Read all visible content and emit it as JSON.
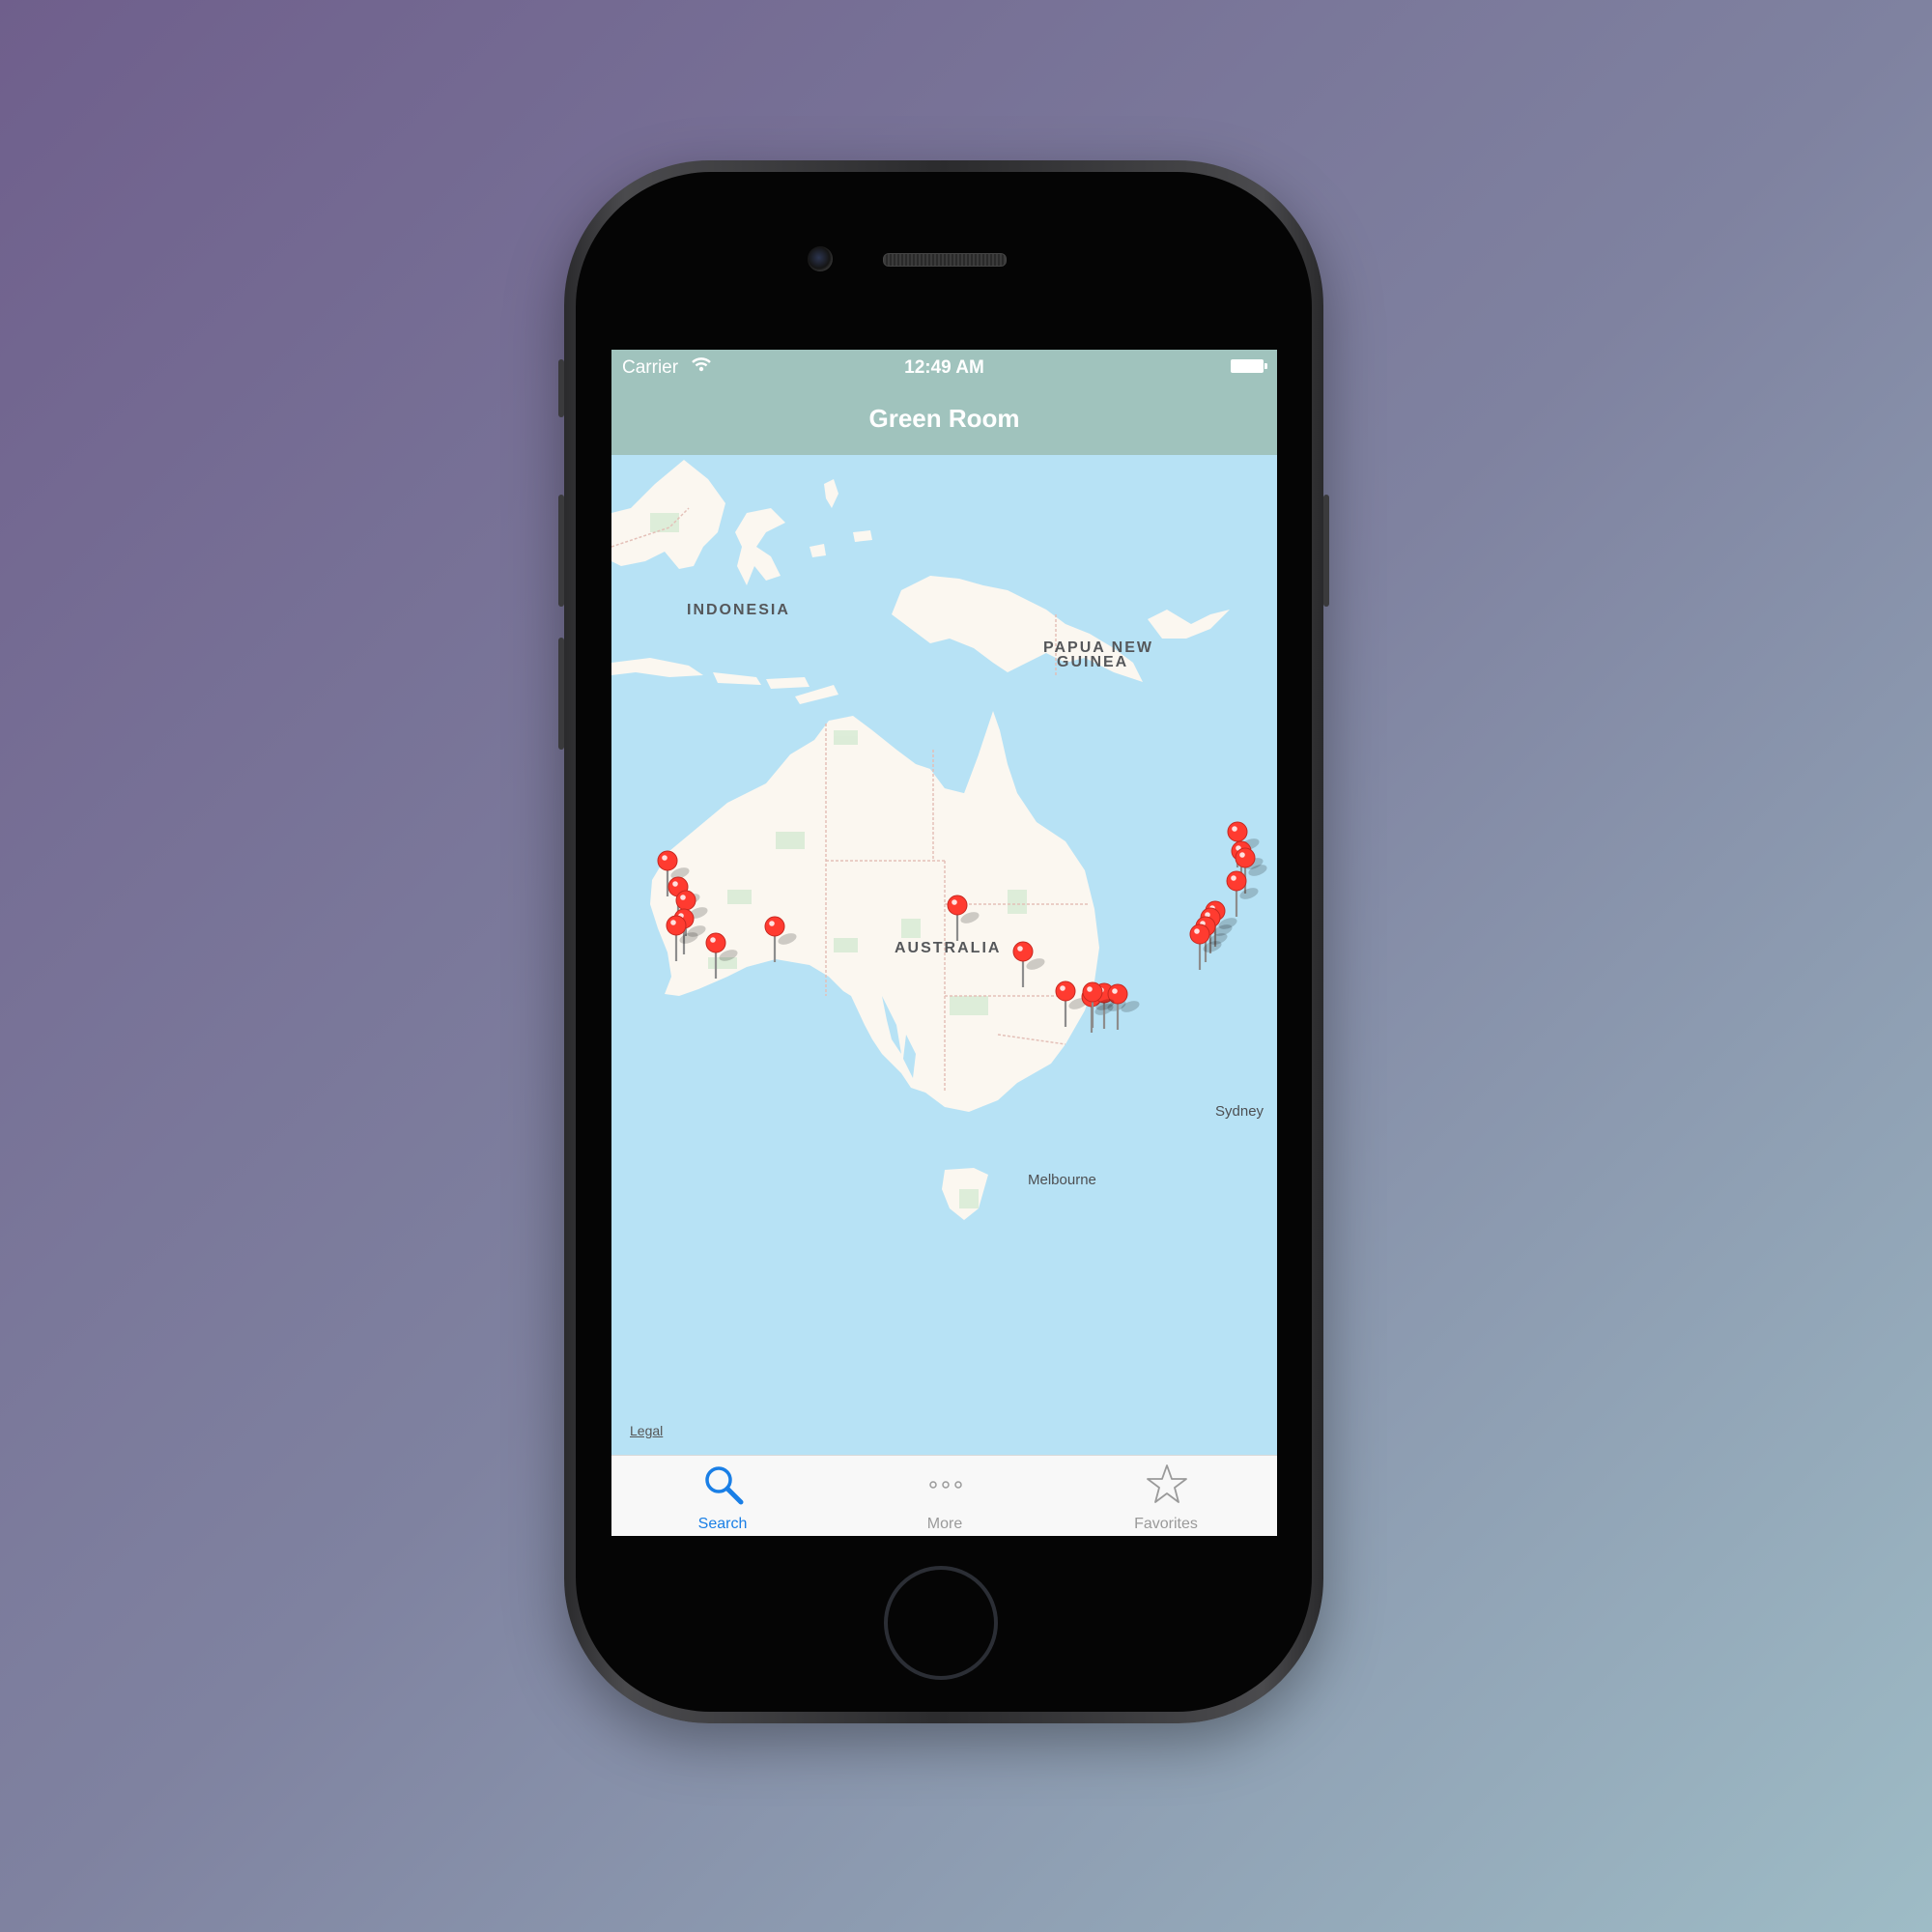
{
  "status_bar": {
    "carrier": "Carrier",
    "time": "12:49 AM"
  },
  "nav_bar": {
    "title": "Green Room"
  },
  "map": {
    "labels": {
      "indonesia": "INDONESIA",
      "png_line1": "PAPUA NEW",
      "png_line2": "GUINEA",
      "australia": "AUSTRALIA"
    },
    "cities": {
      "sydney": "Sydney",
      "melbourne": "Melbourne"
    },
    "legal": "Legal",
    "pin_color": "#ff3b30"
  },
  "tab_bar": {
    "tabs": [
      {
        "label": "Search",
        "icon": "magnifier-icon",
        "active": true
      },
      {
        "label": "More",
        "icon": "more-dots-icon",
        "active": false
      },
      {
        "label": "Favorites",
        "icon": "star-icon",
        "active": false
      }
    ],
    "active_color": "#1a7fe6",
    "inactive_color": "#9a9a9a"
  },
  "colors": {
    "nav_background": "#a0c3bd",
    "water": "#b7e2f5",
    "land": "#fbf7f0"
  }
}
